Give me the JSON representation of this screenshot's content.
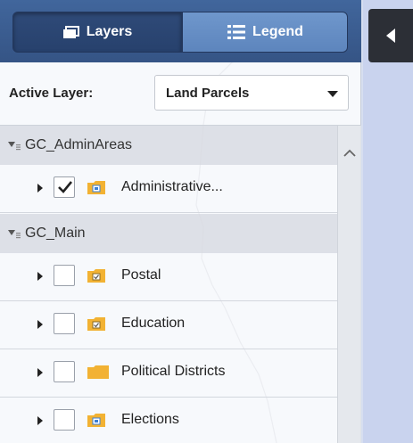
{
  "tabs": {
    "layers_label": "Layers",
    "legend_label": "Legend",
    "selected": "Legend"
  },
  "active_layer": {
    "label": "Active Layer:",
    "value": "Land Parcels"
  },
  "groups": [
    {
      "name": "GC_AdminAreas",
      "layers": [
        {
          "name": "Administrative...",
          "checked": true,
          "folder_icon": "folder-group-icon"
        }
      ]
    },
    {
      "name": "GC_Main",
      "layers": [
        {
          "name": "Postal",
          "checked": false,
          "folder_icon": "folder-checked-icon"
        },
        {
          "name": "Education",
          "checked": false,
          "folder_icon": "folder-checked-icon"
        },
        {
          "name": "Political Districts",
          "checked": false,
          "folder_icon": "folder-plain-icon"
        },
        {
          "name": "Elections",
          "checked": false,
          "folder_icon": "folder-group-icon"
        }
      ]
    }
  ],
  "colors": {
    "header": "#3a5a8a",
    "legend_tab": "#6a92c8",
    "collapse_button": "#2c2f36",
    "folder": "#f2b233",
    "map_background": "#d6def0"
  }
}
